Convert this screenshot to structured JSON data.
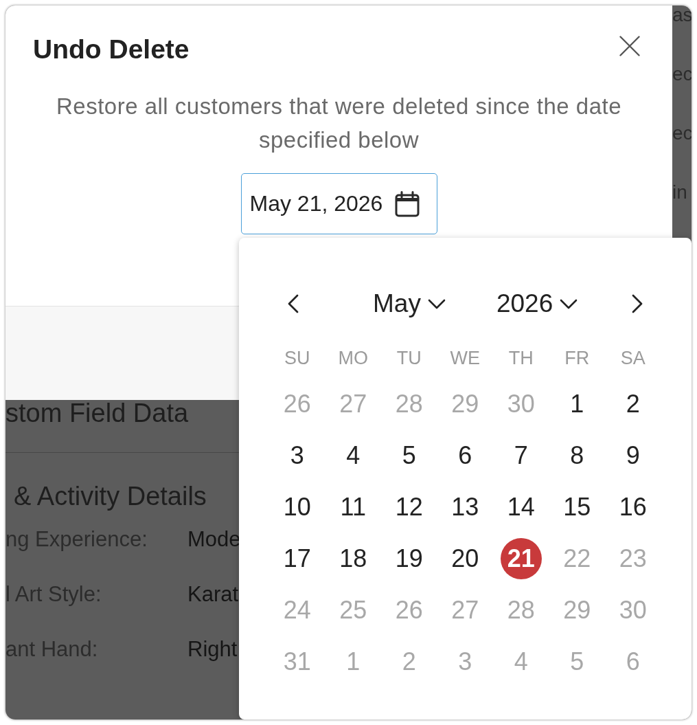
{
  "background": {
    "right_fragments": [
      "as",
      "ec",
      "ec",
      "in"
    ],
    "section_title": "stom Field Data",
    "section_heading": "& Activity Details",
    "fields": [
      {
        "label": "ng Experience:",
        "value": "Mode"
      },
      {
        "label": "l Art Style:",
        "value": "Karat"
      },
      {
        "label": "ant Hand:",
        "value": "Right"
      }
    ]
  },
  "dialog": {
    "title": "Undo Delete",
    "description": "Restore all customers that were deleted since the date specified below",
    "date_value": "May 21, 2026"
  },
  "date_picker": {
    "month": "May",
    "year": "2026",
    "weekdays": [
      "SU",
      "MO",
      "TU",
      "WE",
      "TH",
      "FR",
      "SA"
    ],
    "days": [
      {
        "label": "26",
        "disabled": true,
        "selected": false
      },
      {
        "label": "27",
        "disabled": true,
        "selected": false
      },
      {
        "label": "28",
        "disabled": true,
        "selected": false
      },
      {
        "label": "29",
        "disabled": true,
        "selected": false
      },
      {
        "label": "30",
        "disabled": true,
        "selected": false
      },
      {
        "label": "1",
        "disabled": false,
        "selected": false
      },
      {
        "label": "2",
        "disabled": false,
        "selected": false
      },
      {
        "label": "3",
        "disabled": false,
        "selected": false
      },
      {
        "label": "4",
        "disabled": false,
        "selected": false
      },
      {
        "label": "5",
        "disabled": false,
        "selected": false
      },
      {
        "label": "6",
        "disabled": false,
        "selected": false
      },
      {
        "label": "7",
        "disabled": false,
        "selected": false
      },
      {
        "label": "8",
        "disabled": false,
        "selected": false
      },
      {
        "label": "9",
        "disabled": false,
        "selected": false
      },
      {
        "label": "10",
        "disabled": false,
        "selected": false
      },
      {
        "label": "11",
        "disabled": false,
        "selected": false
      },
      {
        "label": "12",
        "disabled": false,
        "selected": false
      },
      {
        "label": "13",
        "disabled": false,
        "selected": false
      },
      {
        "label": "14",
        "disabled": false,
        "selected": false
      },
      {
        "label": "15",
        "disabled": false,
        "selected": false
      },
      {
        "label": "16",
        "disabled": false,
        "selected": false
      },
      {
        "label": "17",
        "disabled": false,
        "selected": false
      },
      {
        "label": "18",
        "disabled": false,
        "selected": false
      },
      {
        "label": "19",
        "disabled": false,
        "selected": false
      },
      {
        "label": "20",
        "disabled": false,
        "selected": false
      },
      {
        "label": "21",
        "disabled": false,
        "selected": true
      },
      {
        "label": "22",
        "disabled": true,
        "selected": false
      },
      {
        "label": "23",
        "disabled": true,
        "selected": false
      },
      {
        "label": "24",
        "disabled": true,
        "selected": false
      },
      {
        "label": "25",
        "disabled": true,
        "selected": false
      },
      {
        "label": "26",
        "disabled": true,
        "selected": false
      },
      {
        "label": "27",
        "disabled": true,
        "selected": false
      },
      {
        "label": "28",
        "disabled": true,
        "selected": false
      },
      {
        "label": "29",
        "disabled": true,
        "selected": false
      },
      {
        "label": "30",
        "disabled": true,
        "selected": false
      },
      {
        "label": "31",
        "disabled": true,
        "selected": false
      },
      {
        "label": "1",
        "disabled": true,
        "selected": false
      },
      {
        "label": "2",
        "disabled": true,
        "selected": false
      },
      {
        "label": "3",
        "disabled": true,
        "selected": false
      },
      {
        "label": "4",
        "disabled": true,
        "selected": false
      },
      {
        "label": "5",
        "disabled": true,
        "selected": false
      },
      {
        "label": "6",
        "disabled": true,
        "selected": false
      }
    ]
  }
}
